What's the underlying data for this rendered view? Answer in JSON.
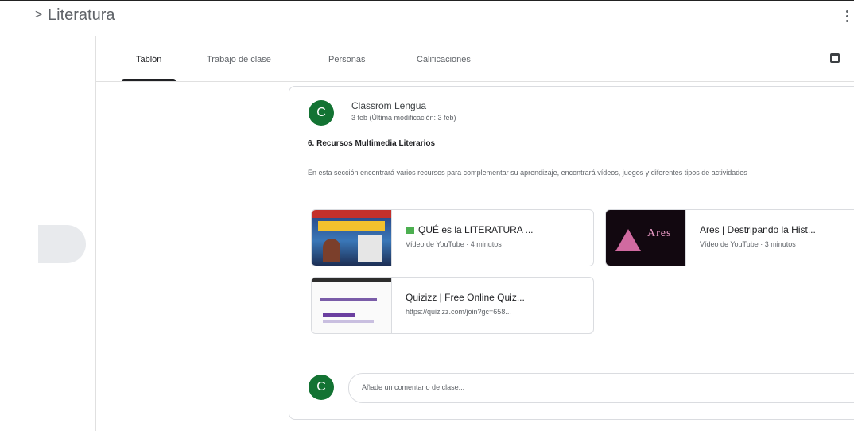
{
  "header": {
    "breadcrumb_separator": ">",
    "course_name": "Literatura"
  },
  "tabs": [
    {
      "label": "Tablón",
      "active": true
    },
    {
      "label": "Trabajo de clase",
      "active": false
    },
    {
      "label": "Personas",
      "active": false
    },
    {
      "label": "Calificaciones",
      "active": false
    }
  ],
  "post": {
    "avatar_letter": "C",
    "author": "Classrom Lengua",
    "date": "3 feb (Última modificación: 3 feb)",
    "title": "6. Recursos Multimedia Literarios",
    "description": "En esta sección encontrará varios recursos para complementar su aprendizaje, encontrará vídeos, juegos y diferentes tipos de actividades",
    "attachments": [
      {
        "title": "QUÉ es la LITERATURA ...",
        "subtitle": "Vídeo de YouTube · 4 minutos",
        "icon": "book-emoji-icon"
      },
      {
        "title": "Ares | Destripando la Hist...",
        "subtitle": "Vídeo de YouTube · 3 minutos",
        "thumb_text": "Ares"
      },
      {
        "title": "Quizizz | Free Online Quiz...",
        "subtitle": "https://quizizz.com/join?gc=658..."
      }
    ]
  },
  "comment": {
    "avatar_letter": "C",
    "placeholder": "Añade un comentario de clase..."
  },
  "colors": {
    "avatar": "#137333",
    "active_tab_indicator": "#202124",
    "border": "#dadce0"
  }
}
